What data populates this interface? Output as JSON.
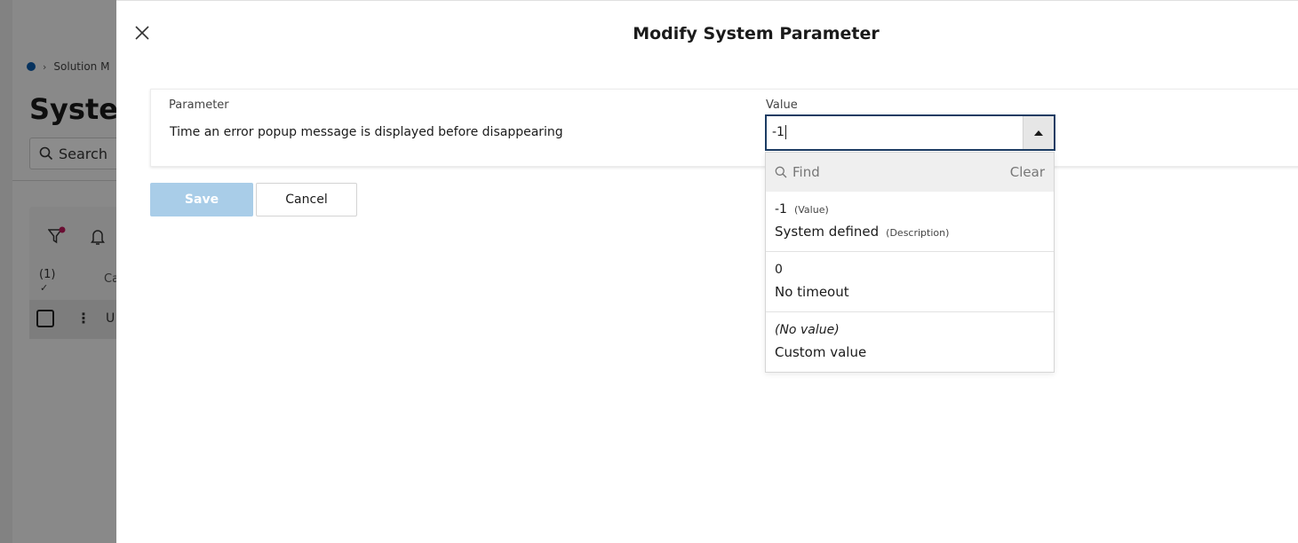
{
  "background": {
    "breadcrumb": "Solution M",
    "title": "System",
    "search_label": "Search",
    "count": "(1)",
    "column": "Ca",
    "row_text": "U"
  },
  "dialog": {
    "title": "Modify System Parameter",
    "parameter_label": "Parameter",
    "parameter_text": "Time an error popup message is displayed before disappearing",
    "value_label": "Value",
    "value_current": "-1",
    "save_label": "Save",
    "cancel_label": "Cancel"
  },
  "dropdown": {
    "find_placeholder": "Find",
    "clear_label": "Clear",
    "options": [
      {
        "value": "-1",
        "value_hint": "(Value)",
        "description": "System defined",
        "description_hint": "(Description)"
      },
      {
        "value": "0",
        "description": "No timeout"
      },
      {
        "value": "(No value)",
        "description": "Custom value"
      }
    ]
  },
  "colors": {
    "accent": "#1c3c63",
    "save_disabled": "#a9cde8",
    "badge": "#c2185b"
  }
}
